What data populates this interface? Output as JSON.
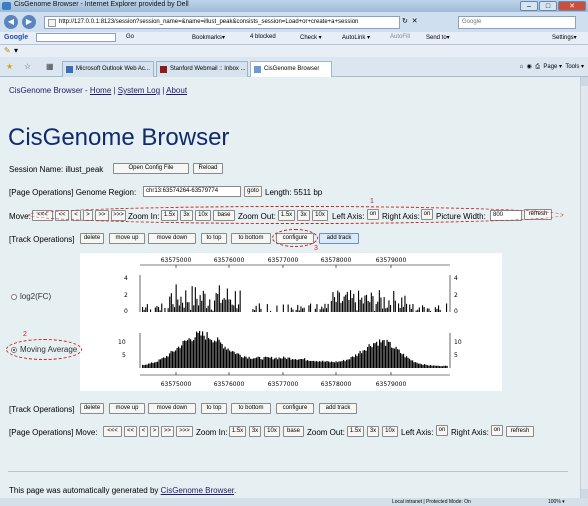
{
  "window": {
    "title": "CisGenome Browser - Internet Explorer provided by Dell",
    "minimize": "–",
    "maximize": "□",
    "close": "✕"
  },
  "address_bar": {
    "url": "http://127.0.0.1:8123/session?session_name=&name=illust_peak&consists_session=Load+or+create+a+session",
    "search_placeholder": "Google",
    "back": "◀",
    "forward": "▶",
    "refresh": "↻",
    "stop": "✕"
  },
  "google_bar": {
    "logo": "Google",
    "go": "Go",
    "bookmarks": "Bookmarks▾",
    "blocked": "4 blocked",
    "check": "Check ▾",
    "autolink": "AutoLink ▾",
    "autofill": "AutoFill",
    "send_to": "Send to▾",
    "settings": "Settings▾"
  },
  "tabs": [
    {
      "label": "Microsoft Outlook Web Ac...",
      "active": false
    },
    {
      "label": "Stanford Webmail :: Inbox ...",
      "active": false
    },
    {
      "label": "CisGenome Browser",
      "active": true
    }
  ],
  "command_bar": {
    "page": "Page ▾",
    "tools": "Tools ▾"
  },
  "page": {
    "nav_prefix": "CisGenome Browser -",
    "nav_home": "Home",
    "nav_system_log": "System Log",
    "nav_about": "About",
    "heading": "CisGenome Browser",
    "session_label": "Session Name: illust_peak",
    "open_config": "Open Config File",
    "reload": "Reload",
    "genome_region_label": "[Page Operations] Genome Region:",
    "genome_region_value": "chr13:63574264-63579774",
    "goto": "goto",
    "length": "Length: 5511 bp",
    "move_label": "Move:",
    "move_buttons": [
      "<<<",
      "<<",
      "<",
      ">",
      ">>",
      ">>>"
    ],
    "zoom_in_label": "Zoom In:",
    "zoom_in_buttons": [
      "1.5x",
      "3x",
      "10x",
      "base"
    ],
    "zoom_out_label": "Zoom Out:",
    "zoom_out_buttons": [
      "1.5x",
      "3x",
      "10x"
    ],
    "left_axis_label": "Left Axis:",
    "left_axis_value": "on",
    "right_axis_label": "Right Axis:",
    "right_axis_value": "on",
    "picture_width_label": "Picture Width:",
    "picture_width_value": "800",
    "refresh": "refresh",
    "track_ops_label": "[Track Operations]",
    "track_buttons": [
      "delete",
      "move up",
      "move down",
      "to top",
      "to bottom",
      "configure",
      "add track"
    ],
    "track1_label": "log2(FC)",
    "track2_label": "Moving Average",
    "annotations": [
      "1",
      "2",
      "3"
    ],
    "axis_ticks": [
      "63575000",
      "63576000",
      "63577000",
      "63578000",
      "63579000"
    ],
    "track1_yticks": [
      "4",
      "2",
      "0"
    ],
    "track2_yticks": [
      "10",
      "5"
    ],
    "bottom_move_prefix": "[Page Operations] Move:",
    "footer_prefix": "This page was automatically generated by",
    "footer_link": "CisGenome Browser",
    "footer_suffix": "."
  },
  "status_bar": {
    "zone": "Local intranet | Protected Mode: On",
    "zoom": "100% ▾"
  },
  "colors": {
    "page_bg": "#e6eff1",
    "link": "#1c1c6e",
    "annotation": "#c82020"
  }
}
